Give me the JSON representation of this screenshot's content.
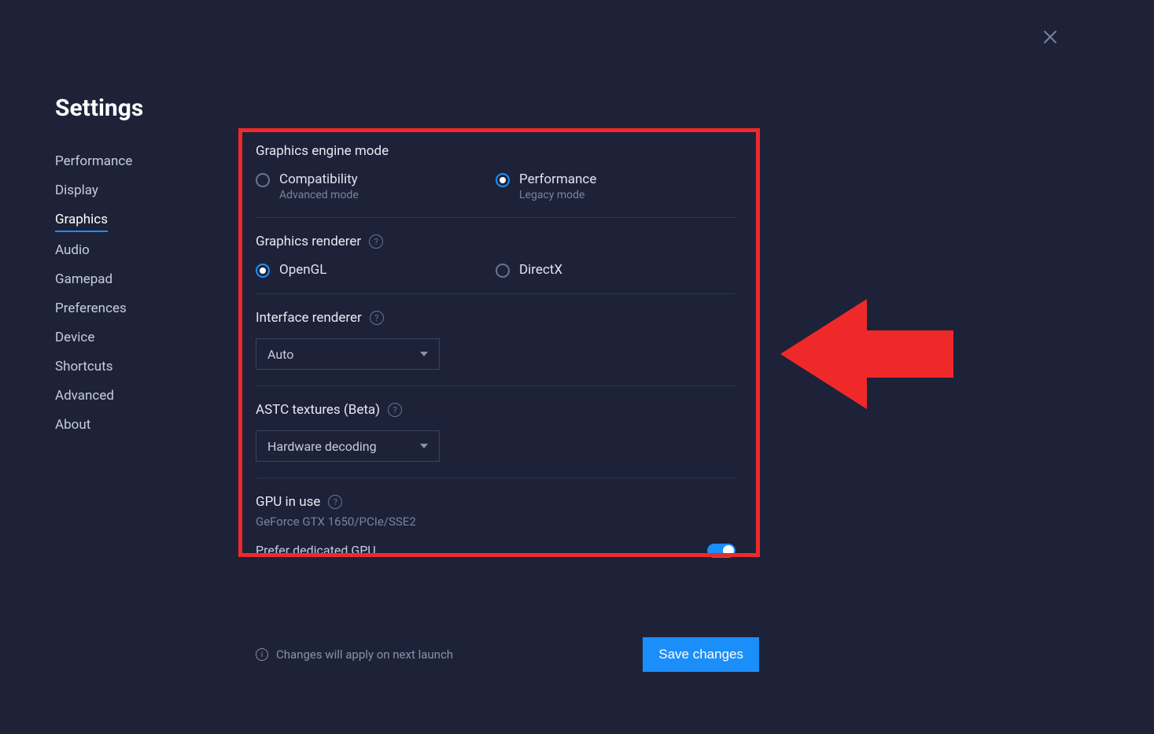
{
  "title": "Settings",
  "sidebar": {
    "items": [
      {
        "label": "Performance"
      },
      {
        "label": "Display"
      },
      {
        "label": "Graphics"
      },
      {
        "label": "Audio"
      },
      {
        "label": "Gamepad"
      },
      {
        "label": "Preferences"
      },
      {
        "label": "Device"
      },
      {
        "label": "Shortcuts"
      },
      {
        "label": "Advanced"
      },
      {
        "label": "About"
      }
    ],
    "active_index": 2
  },
  "sections": {
    "engine_mode": {
      "title": "Graphics engine mode",
      "options": [
        {
          "label": "Compatibility",
          "sub": "Advanced mode"
        },
        {
          "label": "Performance",
          "sub": "Legacy mode"
        }
      ],
      "selected_index": 1
    },
    "renderer": {
      "title": "Graphics renderer",
      "options": [
        {
          "label": "OpenGL"
        },
        {
          "label": "DirectX"
        }
      ],
      "selected_index": 0
    },
    "interface_renderer": {
      "title": "Interface renderer",
      "value": "Auto"
    },
    "astc": {
      "title": "ASTC textures (Beta)",
      "value": "Hardware decoding"
    },
    "gpu": {
      "title": "GPU in use",
      "detail": "GeForce GTX 1650/PCIe/SSE2",
      "toggle_label": "Prefer dedicated GPU",
      "toggle_on": true
    }
  },
  "footer": {
    "note": "Changes will apply on next launch",
    "save": "Save changes"
  }
}
